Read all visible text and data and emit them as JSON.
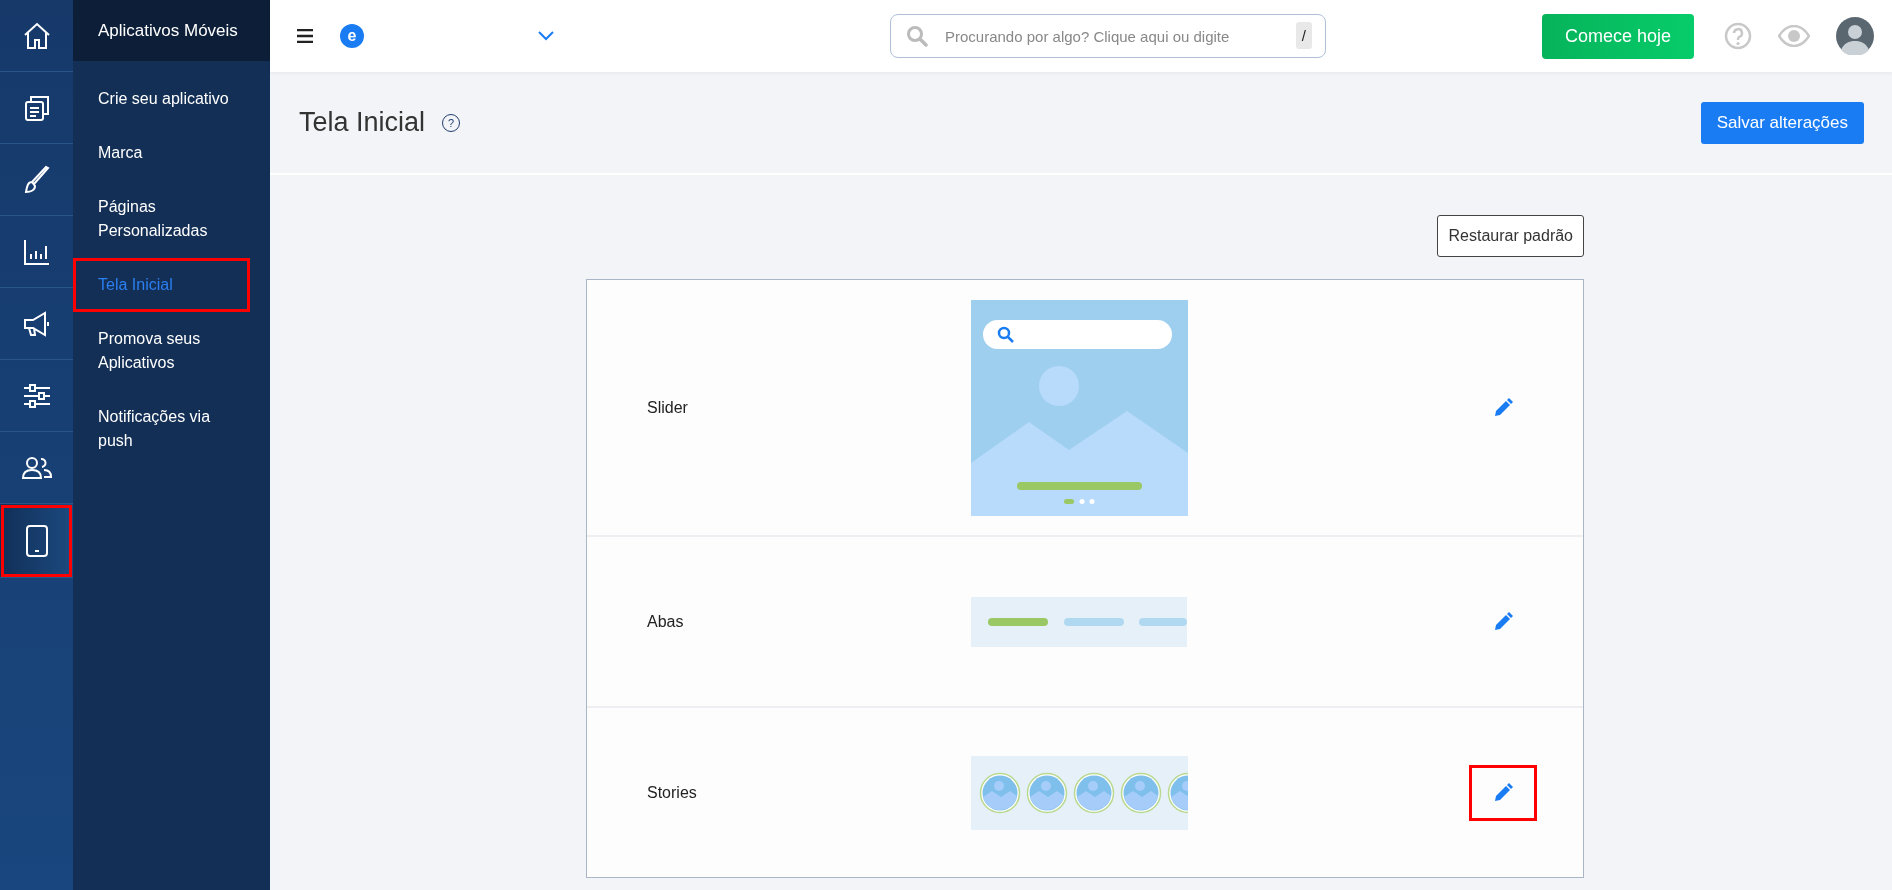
{
  "rail": [
    {
      "selected": false,
      "highlighted": false
    },
    {
      "selected": false,
      "highlighted": false
    },
    {
      "selected": false,
      "highlighted": false
    },
    {
      "selected": false,
      "highlighted": false
    },
    {
      "selected": false,
      "highlighted": false
    },
    {
      "selected": false,
      "highlighted": false
    },
    {
      "selected": false,
      "highlighted": false
    },
    {
      "selected": true,
      "highlighted": true
    }
  ],
  "submenu": {
    "title": "Aplicativos Móveis",
    "items": [
      {
        "label": "Crie seu aplicativo",
        "selected": false,
        "highlighted": false
      },
      {
        "label": "Marca",
        "selected": false,
        "highlighted": false
      },
      {
        "label": "Páginas Personalizadas",
        "selected": false,
        "highlighted": false
      },
      {
        "label": "Tela Inicial",
        "selected": true,
        "highlighted": true
      },
      {
        "label": "Promova seus Aplicativos",
        "selected": false,
        "highlighted": false
      },
      {
        "label": "Notificações via push",
        "selected": false,
        "highlighted": false
      }
    ]
  },
  "topbar": {
    "logo_letter": "e",
    "search": {
      "placeholder": "Procurando por algo? Clique aqui ou digite",
      "shortcut": "/"
    },
    "cta": "Comece hoje"
  },
  "page": {
    "title": "Tela Inicial",
    "help": "?",
    "save": "Salvar alterações",
    "restore": "Restaurar padrão"
  },
  "sections": [
    {
      "label": "Slider",
      "kind": "slider",
      "highlighted": false
    },
    {
      "label": "Abas",
      "kind": "tabs",
      "highlighted": false
    },
    {
      "label": "Stories",
      "kind": "stories",
      "highlighted": true
    }
  ]
}
